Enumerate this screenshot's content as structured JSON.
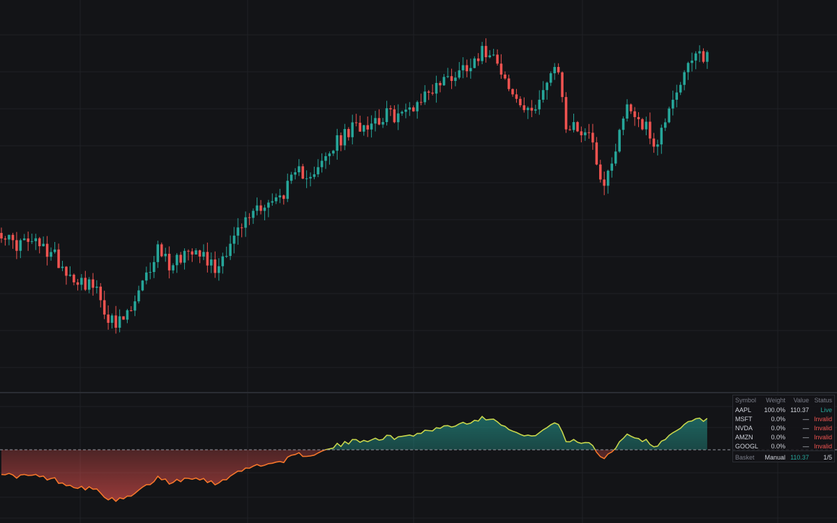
{
  "colors": {
    "background": "#131417",
    "grid": "#1f2126",
    "up": "#26a69a",
    "down": "#ef5350",
    "zero_line": "#9598a1",
    "divider": "#2a2d33"
  },
  "chart_data": [
    {
      "type": "candlestick",
      "grid": true,
      "ylim": [
        0,
        10.5
      ],
      "x": {
        "count": 186
      },
      "close_path": [
        [
          0,
          4.4
        ],
        [
          3,
          3.9
        ],
        [
          8,
          4.0
        ],
        [
          14,
          3.5
        ],
        [
          18,
          2.8
        ],
        [
          24,
          2.4
        ],
        [
          28,
          1.3
        ],
        [
          30,
          0.9
        ],
        [
          34,
          1.5
        ],
        [
          38,
          2.7
        ],
        [
          41,
          3.8
        ],
        [
          44,
          3.2
        ],
        [
          51,
          3.9
        ],
        [
          56,
          3.0
        ],
        [
          60,
          4.0
        ],
        [
          67,
          5.3
        ],
        [
          72,
          5.5
        ],
        [
          78,
          6.5
        ],
        [
          83,
          6.6
        ],
        [
          88,
          7.6
        ],
        [
          93,
          8.2
        ],
        [
          101,
          8.6
        ],
        [
          105,
          8.6
        ],
        [
          114,
          9.7
        ],
        [
          120,
          10.2
        ],
        [
          125,
          10.8
        ],
        [
          128,
          11.0
        ],
        [
          130,
          10.7
        ],
        [
          133,
          9.5
        ],
        [
          138,
          8.6
        ],
        [
          144,
          10.0
        ],
        [
          146,
          10.2
        ],
        [
          148,
          8.2
        ],
        [
          154,
          8.0
        ],
        [
          158,
          6.0
        ],
        [
          164,
          9.0
        ],
        [
          167,
          8.5
        ],
        [
          172,
          7.5
        ],
        [
          175,
          9.0
        ],
        [
          178,
          9.8
        ],
        [
          182,
          10.7
        ],
        [
          185,
          10.8
        ]
      ],
      "noise_seed": 17
    },
    {
      "type": "area",
      "grid": true,
      "baseline": 0,
      "ylim": [
        -9,
        5
      ],
      "note_line": "dashed zero line",
      "derived_from": "candlestick",
      "offset": -7.1
    }
  ],
  "basket": {
    "headers": [
      "Symbol",
      "Weight",
      "Value",
      "Status"
    ],
    "rows": [
      {
        "symbol": "AAPL",
        "weight": "100.0%",
        "value": "110.37",
        "status": "Live",
        "status_kind": "live"
      },
      {
        "symbol": "MSFT",
        "weight": "0.0%",
        "value": "—",
        "status": "Invalid",
        "status_kind": "invalid"
      },
      {
        "symbol": "NVDA",
        "weight": "0.0%",
        "value": "—",
        "status": "Invalid",
        "status_kind": "invalid"
      },
      {
        "symbol": "AMZN",
        "weight": "0.0%",
        "value": "—",
        "status": "Invalid",
        "status_kind": "invalid"
      },
      {
        "symbol": "GOOGL",
        "weight": "0.0%",
        "value": "—",
        "status": "Invalid",
        "status_kind": "invalid"
      }
    ],
    "footer": {
      "label": "Basket",
      "mode": "Manual",
      "value": "110.37",
      "count": "1/5"
    }
  }
}
